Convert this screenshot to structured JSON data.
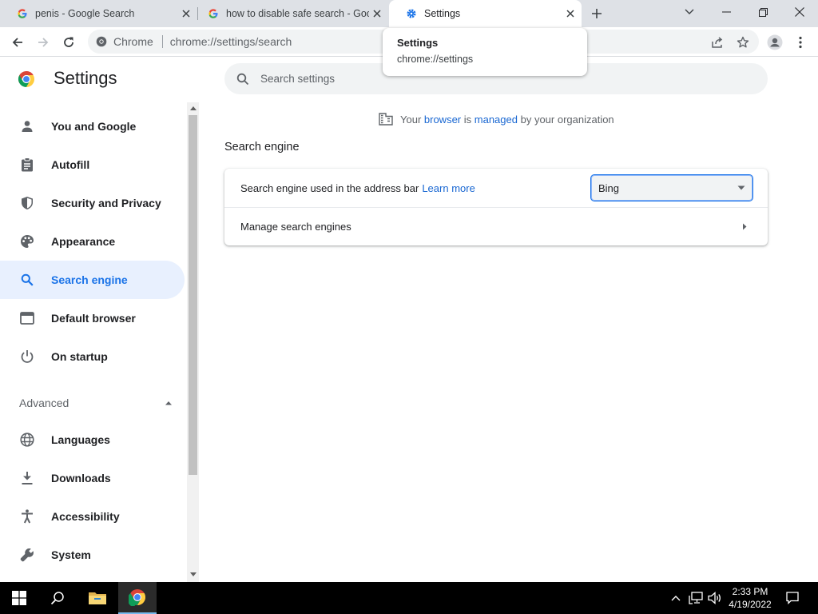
{
  "tabs": [
    {
      "title": "penis - Google Search",
      "icon": "google-icon"
    },
    {
      "title": "how to disable safe search - Google Search",
      "icon": "google-icon"
    },
    {
      "title": "Settings",
      "icon": "gear-icon"
    }
  ],
  "tab_hover": {
    "title": "Settings",
    "url": "chrome://settings"
  },
  "omnibox": {
    "chip_label": "Chrome",
    "url": "chrome://settings/search"
  },
  "settings": {
    "title": "Settings",
    "search_placeholder": "Search settings"
  },
  "sidebar": {
    "items": [
      {
        "label": "You and Google",
        "icon": "person-icon"
      },
      {
        "label": "Autofill",
        "icon": "clipboard-icon"
      },
      {
        "label": "Security and Privacy",
        "icon": "shield-icon"
      },
      {
        "label": "Appearance",
        "icon": "palette-icon"
      },
      {
        "label": "Search engine",
        "icon": "search-icon",
        "active": true
      },
      {
        "label": "Default browser",
        "icon": "browser-window-icon"
      },
      {
        "label": "On startup",
        "icon": "power-icon"
      }
    ],
    "advanced_label": "Advanced",
    "advanced_items": [
      {
        "label": "Languages",
        "icon": "globe-icon"
      },
      {
        "label": "Downloads",
        "icon": "download-icon"
      },
      {
        "label": "Accessibility",
        "icon": "accessibility-icon"
      },
      {
        "label": "System",
        "icon": "wrench-icon"
      }
    ]
  },
  "managed_notice": {
    "prefix": "Your ",
    "link1": "browser",
    "middle": " is ",
    "link2": "managed",
    "suffix": " by your organization"
  },
  "search_engine": {
    "section_title": "Search engine",
    "address_bar_label": "Search engine used in the address bar",
    "learn_more": "Learn more",
    "selected_engine": "Bing",
    "manage_label": "Manage search engines"
  },
  "taskbar": {
    "time": "2:33 PM",
    "date": "4/19/2022"
  },
  "colors": {
    "accent": "#1a73e8",
    "active_nav_bg": "#e8f0fe",
    "link": "#1967d2"
  }
}
